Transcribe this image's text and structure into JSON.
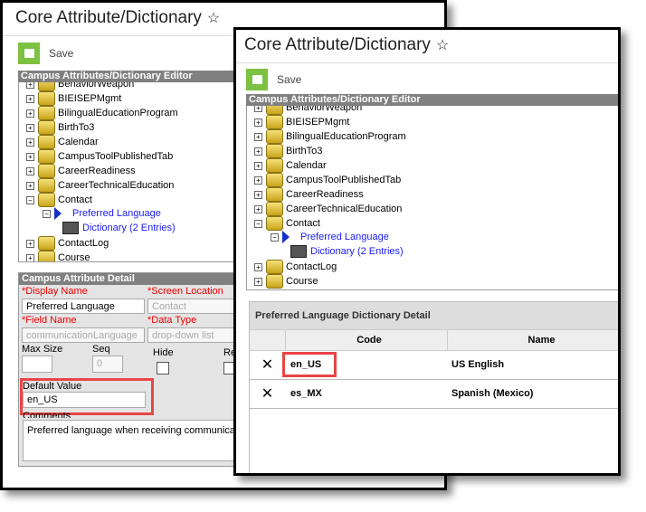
{
  "title": "Core Attribute/Dictionary",
  "save_label": "Save",
  "tree_header": "Campus Attributes/Dictionary Editor",
  "tree_items": [
    {
      "label": "BehaviorWeapon",
      "type": "folder",
      "exp": "+"
    },
    {
      "label": "BIEISEPMgmt",
      "type": "folder",
      "exp": "+"
    },
    {
      "label": "BilingualEducationProgram",
      "type": "folder",
      "exp": "+"
    },
    {
      "label": "BirthTo3",
      "type": "folder",
      "exp": "+"
    },
    {
      "label": "Calendar",
      "type": "folder",
      "exp": "+"
    },
    {
      "label": "CampusToolPublishedTab",
      "type": "folder",
      "exp": "+"
    },
    {
      "label": "CareerReadiness",
      "type": "folder",
      "exp": "+"
    },
    {
      "label": "CareerTechnicalEducation",
      "type": "folder",
      "exp": "+"
    },
    {
      "label": "Contact",
      "type": "folder",
      "exp": "−"
    },
    {
      "label": "Preferred Language",
      "type": "attribute",
      "exp": "−"
    },
    {
      "label": "Dictionary (2 Entries)",
      "type": "dictionary",
      "exp": ""
    },
    {
      "label": "ContactLog",
      "type": "folder",
      "exp": "+"
    },
    {
      "label": "Course",
      "type": "folder",
      "exp": "+"
    }
  ],
  "detail": {
    "header": "Campus Attribute Detail",
    "display_name_label": "*Display Name",
    "display_name": "Preferred Language",
    "screen_location_label": "*Screen Location",
    "screen_location": "Contact",
    "field_name_label": "*Field Name",
    "field_name": "communicationLanguage",
    "data_type_label": "*Data Type",
    "data_type": "drop-down list",
    "max_size_label": "Max Size",
    "max_size": "",
    "seq_label": "Seq",
    "seq": "0",
    "hide_label": "Hide",
    "hide": false,
    "req_label": "Req",
    "default_value_label": "Default Value",
    "default_value": "en_US",
    "comments_label": "Comments",
    "comments": "Preferred language when receiving communicati"
  },
  "dictionary": {
    "header": "Preferred Language Dictionary Detail",
    "columns": [
      "Code",
      "Name"
    ],
    "rows": [
      {
        "code": "en_US",
        "name": "US English"
      },
      {
        "code": "es_MX",
        "name": "Spanish (Mexico)"
      }
    ]
  },
  "colors": {
    "save": "#7dc142",
    "highlight": "#e84545",
    "link": "#1a1aff",
    "required": "#e00000"
  }
}
